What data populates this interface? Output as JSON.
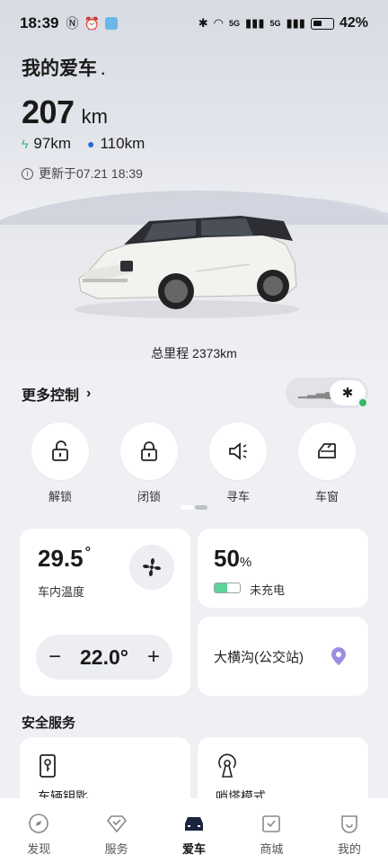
{
  "status_bar": {
    "time": "18:39",
    "signal1": "5G",
    "signal2": "5G",
    "battery": "42%"
  },
  "header": {
    "title": "我的爱车",
    "range_value": "207",
    "range_unit": "km",
    "electric_range": "97km",
    "fuel_range": "110km",
    "updated": "更新于07.21 18:39"
  },
  "odometer": "总里程 2373km",
  "more_controls": "更多控制",
  "controls": [
    {
      "label": "解锁",
      "icon": "unlock-icon"
    },
    {
      "label": "闭锁",
      "icon": "lock-icon"
    },
    {
      "label": "寻车",
      "icon": "horn-icon"
    },
    {
      "label": "车窗",
      "icon": "window-icon"
    }
  ],
  "climate": {
    "temperature": "29.5",
    "degree": "°",
    "caption": "车内温度",
    "set_temp": "22.0°",
    "minus": "−",
    "plus": "+"
  },
  "battery": {
    "percent": "50",
    "percent_sign": "%",
    "status": "未充电",
    "level": 0.5,
    "bar_color": "#5cd39a"
  },
  "location": {
    "place": "大横沟(公交站)"
  },
  "safety": {
    "title": "安全服务",
    "services": [
      {
        "name": "车辆钥匙",
        "icon": "key-icon"
      },
      {
        "name": "哨塔模式",
        "icon": "sentry-icon"
      }
    ]
  },
  "tabs": [
    {
      "label": "发现",
      "icon": "compass-icon"
    },
    {
      "label": "服务",
      "icon": "service-icon"
    },
    {
      "label": "爱车",
      "icon": "car-icon",
      "active": true
    },
    {
      "label": "商城",
      "icon": "shop-icon"
    },
    {
      "label": "我的",
      "icon": "profile-icon"
    }
  ],
  "colors": {
    "accent_green": "#37b866",
    "fuel_blue": "#2c67d6",
    "pin_purple": "#9a8fe0"
  }
}
